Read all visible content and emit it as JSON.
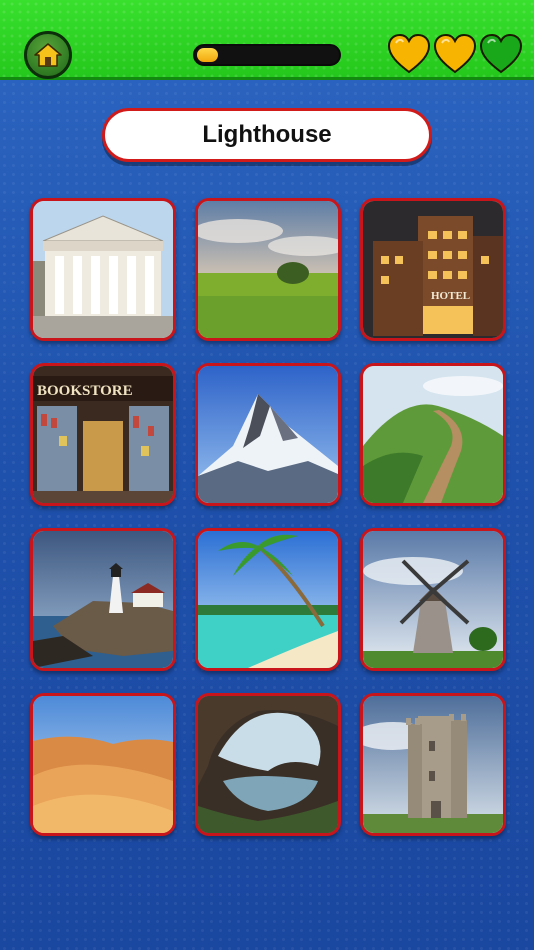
{
  "header": {
    "home_icon": "home-icon",
    "progress": 0.15,
    "lives": {
      "total": 3,
      "remaining": 2
    },
    "colors": {
      "bar": "#2bd023",
      "heart_full": "#f7b400",
      "heart_empty": "#18a81a",
      "progress_fill": "#f6b417"
    }
  },
  "prompt": {
    "word": "Lighthouse"
  },
  "grid": {
    "tiles": [
      {
        "subject": "columned-building"
      },
      {
        "subject": "green-meadow"
      },
      {
        "subject": "hotel",
        "sign": "HOTEL"
      },
      {
        "subject": "bookstore",
        "sign": "BOOKSTORE"
      },
      {
        "subject": "snowy-mountain"
      },
      {
        "subject": "hill-path"
      },
      {
        "subject": "lighthouse"
      },
      {
        "subject": "tropical-beach"
      },
      {
        "subject": "windmill"
      },
      {
        "subject": "desert-dunes"
      },
      {
        "subject": "cave"
      },
      {
        "subject": "castle-tower"
      }
    ]
  }
}
